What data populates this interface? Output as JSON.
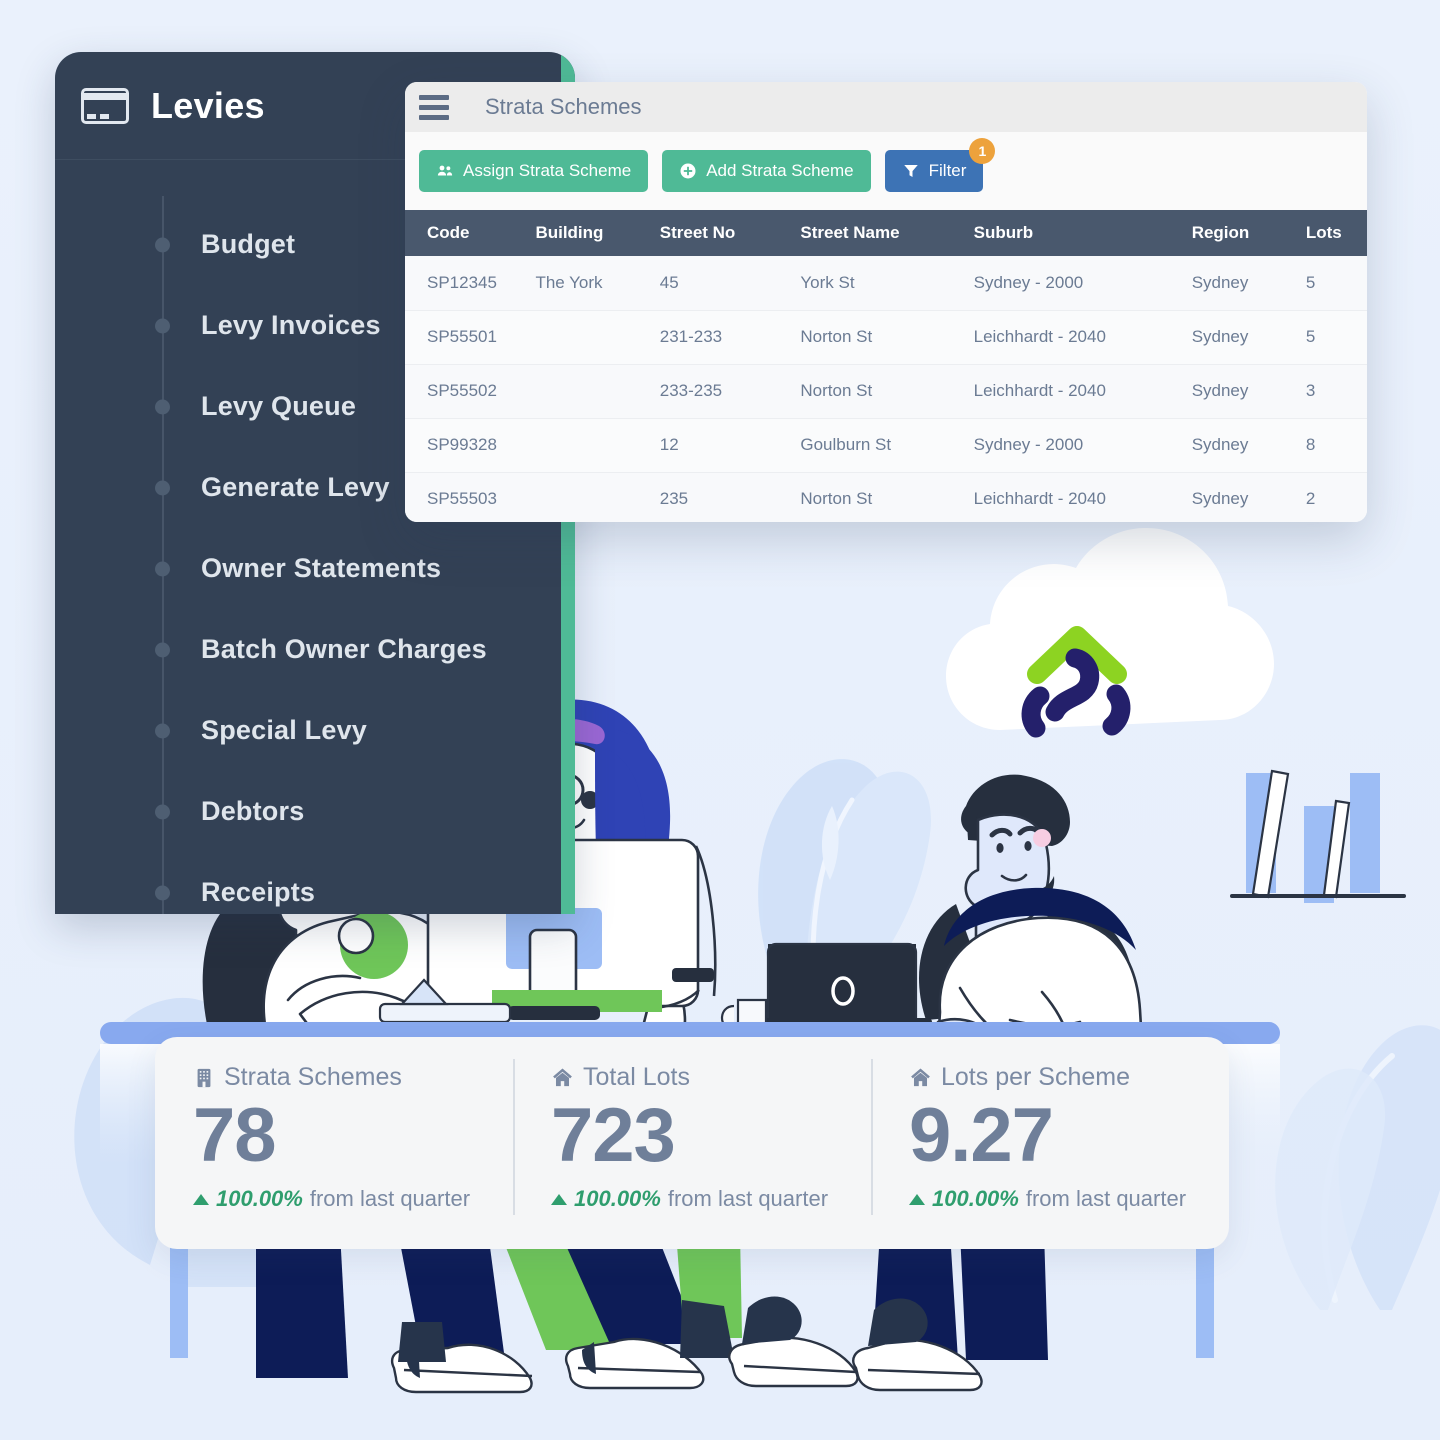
{
  "background_color": "#e8f0fb",
  "accent_green": "#4fba96",
  "accent_blue": "#3d73b5",
  "sidebar": {
    "icon": "credit-card-icon",
    "title": "Levies",
    "items": [
      {
        "label": "Budget"
      },
      {
        "label": "Levy Invoices"
      },
      {
        "label": "Levy Queue"
      },
      {
        "label": "Generate Levy"
      },
      {
        "label": "Owner Statements"
      },
      {
        "label": "Batch Owner Charges"
      },
      {
        "label": "Special Levy"
      },
      {
        "label": "Debtors"
      },
      {
        "label": "Receipts"
      }
    ]
  },
  "window": {
    "menu_icon": "hamburger-icon",
    "title": "Strata Schemes",
    "toolbar": {
      "assign_label": "Assign Strata Scheme",
      "assign_icon": "users-icon",
      "add_label": "Add Strata Scheme",
      "add_icon": "plus-circle-icon",
      "filter_label": "Filter",
      "filter_icon": "funnel-icon",
      "filter_badge": "1"
    },
    "table": {
      "columns": [
        "Code",
        "Building",
        "Street No",
        "Street Name",
        "Suburb",
        "Region",
        "Lots"
      ],
      "rows": [
        {
          "code": "SP12345",
          "building": "The York",
          "street_no": "45",
          "street_name": "York St",
          "suburb": "Sydney - 2000",
          "region": "Sydney",
          "lots": "5"
        },
        {
          "code": "SP55501",
          "building": "",
          "street_no": "231-233",
          "street_name": "Norton St",
          "suburb": "Leichhardt - 2040",
          "region": "Sydney",
          "lots": "5"
        },
        {
          "code": "SP55502",
          "building": "",
          "street_no": "233-235",
          "street_name": "Norton St",
          "suburb": "Leichhardt - 2040",
          "region": "Sydney",
          "lots": "3"
        },
        {
          "code": "SP99328",
          "building": "",
          "street_no": "12",
          "street_name": "Goulburn St",
          "suburb": "Sydney - 2000",
          "region": "Sydney",
          "lots": "8"
        },
        {
          "code": "SP55503",
          "building": "",
          "street_no": "235",
          "street_name": "Norton St",
          "suburb": "Leichhardt - 2040",
          "region": "Sydney",
          "lots": "2"
        }
      ]
    }
  },
  "stats": [
    {
      "icon": "building-icon",
      "label": "Strata Schemes",
      "value": "78",
      "delta": "100.00%",
      "delta_suffix": "from last quarter",
      "delta_color": "#2f9e6e"
    },
    {
      "icon": "home-icon",
      "label": "Total Lots",
      "value": "723",
      "delta": "100.00%",
      "delta_suffix": "from last quarter",
      "delta_color": "#2f9e6e"
    },
    {
      "icon": "home-icon",
      "label": "Lots per Scheme",
      "value": "9.27",
      "delta": "100.00%",
      "delta_suffix": "from last quarter",
      "delta_color": "#2f9e6e"
    }
  ],
  "illustration": {
    "logo": "cloud-house-logo",
    "scene": "team-at-desk-illustration"
  }
}
